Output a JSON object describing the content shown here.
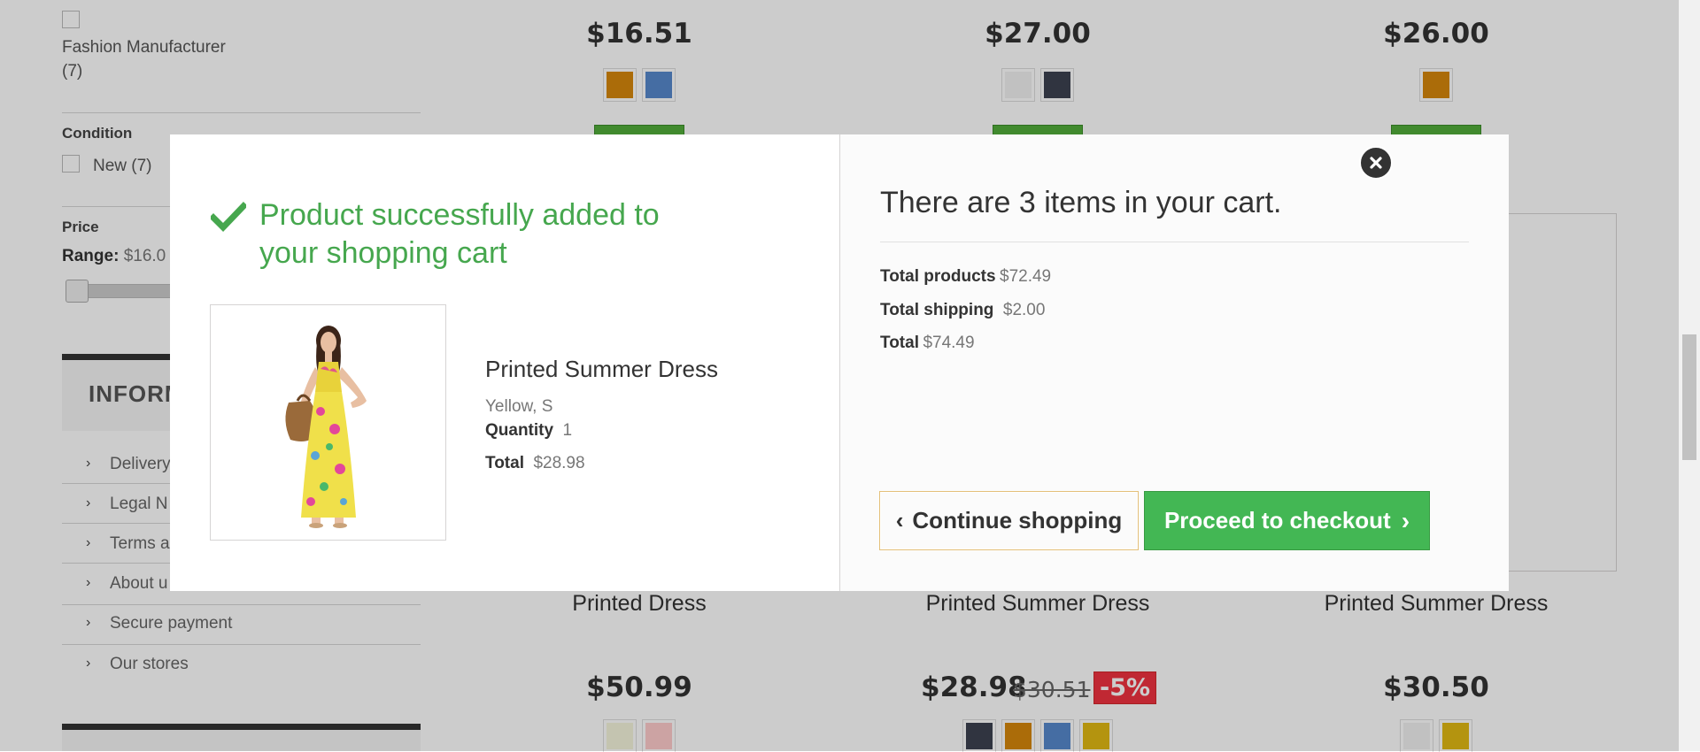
{
  "sidebar": {
    "manufacturer": {
      "name": "Fashion Manufacturer",
      "count": "(7)"
    },
    "condition": {
      "heading": "Condition",
      "option": "New (7)"
    },
    "price": {
      "heading": "Price",
      "range_label": "Range:",
      "range_value": "$16.0"
    },
    "information": {
      "title": "INFORM",
      "links": [
        "Delivery",
        "Legal N",
        "Terms a",
        "About u",
        "Secure payment",
        "Our stores"
      ]
    }
  },
  "products": {
    "top_row": [
      {
        "price": "$16.51",
        "swatches": [
          "#d6870c",
          "#5789cc"
        ]
      },
      {
        "price": "$27.00",
        "swatches": [
          "#f2f2f2",
          "#3c4150"
        ]
      },
      {
        "price": "$26.00",
        "swatches": [
          "#d6870c"
        ]
      }
    ],
    "bottom_row": [
      {
        "name": "Printed Dress",
        "price": "$50.99",
        "old_price": "",
        "discount": "",
        "swatches": [
          "#f5f5dc",
          "#fcc"
        ]
      },
      {
        "name": "Printed Summer Dress",
        "price": "$28.98",
        "old_price": "$30.51",
        "discount": "-5%",
        "swatches": [
          "#3c4150",
          "#d6870c",
          "#5789cc",
          "#e2ba13"
        ]
      },
      {
        "name": "Printed Summer Dress",
        "price": "$30.50",
        "old_price": "",
        "discount": "",
        "swatches": [
          "#f2f2f2",
          "#e2ba13"
        ]
      }
    ]
  },
  "modal": {
    "success_message": "Product successfully added to your shopping cart",
    "success_line1": "Product successfully added to",
    "success_line2": "your shopping cart",
    "product": {
      "name": "Printed Summer Dress",
      "attributes": "Yellow, S",
      "quantity_label": "Quantity",
      "quantity": "1",
      "total_label": "Total",
      "total": "$28.98"
    },
    "cart": {
      "title": "There are 3 items in your cart.",
      "total_products_label": "Total products",
      "total_products": "$72.49",
      "total_shipping_label": "Total shipping",
      "total_shipping": "$2.00",
      "total_label": "Total",
      "total": "$74.49"
    },
    "buttons": {
      "continue": "Continue shopping",
      "checkout": "Proceed to checkout"
    }
  },
  "colors": {
    "success_green": "#46a74e",
    "checkout_green": "#43b754",
    "discount_red": "#f13340"
  }
}
